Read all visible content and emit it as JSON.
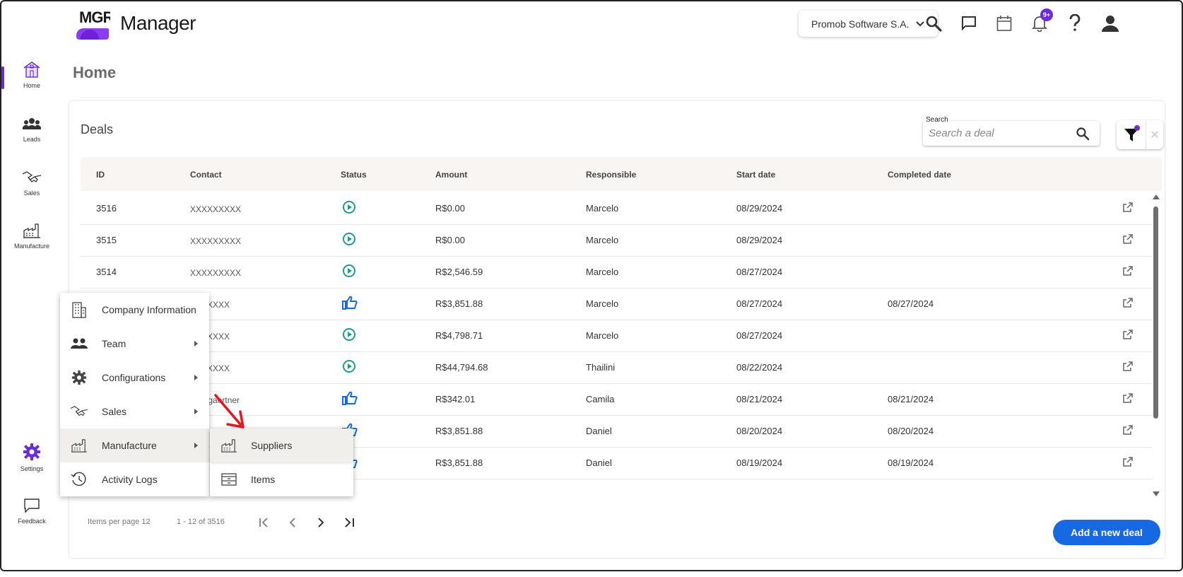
{
  "app": {
    "logo_text": "MGR",
    "title": "Manager"
  },
  "header": {
    "company": "Promob Software S.A.",
    "notification_badge": "9+",
    "icons": [
      "search-icon",
      "chat-icon",
      "calendar-icon",
      "bell-icon",
      "help-icon",
      "account-icon"
    ]
  },
  "rail": {
    "home": "Home",
    "leads": "Leads",
    "sales": "Sales",
    "manufacture": "Manufacture",
    "settings": "Settings",
    "feedback": "Feedback"
  },
  "page": {
    "title": "Home"
  },
  "deals": {
    "title": "Deals",
    "search_label": "Search",
    "search_placeholder": "Search a deal",
    "columns": [
      "ID",
      "Contact",
      "Status",
      "Amount",
      "Responsible",
      "Start date",
      "Completed date"
    ],
    "rows": [
      {
        "id": "3516",
        "contact": "XXXXXXXXX",
        "status": "in-progress",
        "amount": "R$0.00",
        "responsible": "Marcelo",
        "start": "08/29/2024",
        "completed": ""
      },
      {
        "id": "3515",
        "contact": "XXXXXXXXX",
        "status": "in-progress",
        "amount": "R$0.00",
        "responsible": "Marcelo",
        "start": "08/29/2024",
        "completed": ""
      },
      {
        "id": "3514",
        "contact": "XXXXXXXXX",
        "status": "in-progress",
        "amount": "R$2,546.59",
        "responsible": "Marcelo",
        "start": "08/27/2024",
        "completed": ""
      },
      {
        "id": "",
        "contact": "XXXXXXX",
        "status": "won",
        "amount": "R$3,851.88",
        "responsible": "Marcelo",
        "start": "08/27/2024",
        "completed": "08/27/2024"
      },
      {
        "id": "",
        "contact": "XXXXXXX",
        "status": "in-progress",
        "amount": "R$4,798.71",
        "responsible": "Marcelo",
        "start": "08/27/2024",
        "completed": ""
      },
      {
        "id": "",
        "contact": "XXXXXXX",
        "status": "in-progress",
        "amount": "R$44,794.68",
        "responsible": "Thailini",
        "start": "08/22/2024",
        "completed": ""
      },
      {
        "id": "",
        "contact": "mila.gaertner",
        "status": "won",
        "amount": "R$342.01",
        "responsible": "Camila",
        "start": "08/21/2024",
        "completed": "08/21/2024"
      },
      {
        "id": "",
        "contact": "",
        "status": "won",
        "amount": "R$3,851.88",
        "responsible": "Daniel",
        "start": "08/20/2024",
        "completed": "08/20/2024"
      },
      {
        "id": "",
        "contact": "",
        "status": "won",
        "amount": "R$3,851.88",
        "responsible": "Daniel",
        "start": "08/19/2024",
        "completed": "08/19/2024"
      }
    ],
    "items_per_page": "Items per page 12",
    "range": "1 - 12 of 3516",
    "add_button": "Add a new deal"
  },
  "settings_menu": {
    "items": [
      {
        "label": "Company Information",
        "icon": "building-icon",
        "submenu": false
      },
      {
        "label": "Team",
        "icon": "team-icon",
        "submenu": true
      },
      {
        "label": "Configurations",
        "icon": "gear-icon",
        "submenu": true
      },
      {
        "label": "Sales",
        "icon": "handshake-icon",
        "submenu": true
      },
      {
        "label": "Manufacture",
        "icon": "factory-icon",
        "submenu": true
      },
      {
        "label": "Activity Logs",
        "icon": "history-icon",
        "submenu": false
      }
    ],
    "manufacture_submenu": [
      {
        "label": "Suppliers",
        "icon": "factory-icon"
      },
      {
        "label": "Items",
        "icon": "drawer-icon"
      }
    ]
  },
  "colors": {
    "accent": "#6c2bd9",
    "primary_button": "#1668e3",
    "status_in_progress": "#1e9e84",
    "status_won": "#1668e3",
    "annotation_arrow": "#e8141b"
  }
}
